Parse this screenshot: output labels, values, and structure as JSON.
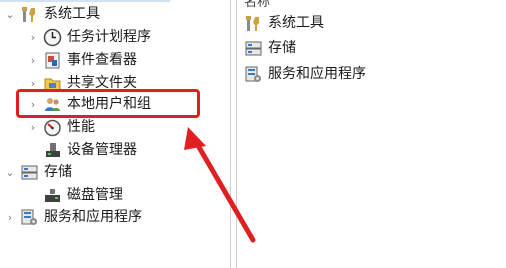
{
  "tree": {
    "items": [
      {
        "label": "系统工具",
        "expander": "expanded",
        "icon": "tools-icon"
      },
      {
        "label": "任务计划程序",
        "expander": "collapsed",
        "icon": "clock-icon"
      },
      {
        "label": "事件查看器",
        "expander": "collapsed",
        "icon": "event-viewer-icon"
      },
      {
        "label": "共享文件夹",
        "expander": "collapsed",
        "icon": "shared-folder-icon"
      },
      {
        "label": "本地用户和组",
        "expander": "collapsed",
        "icon": "users-icon"
      },
      {
        "label": "性能",
        "expander": "collapsed",
        "icon": "performance-icon"
      },
      {
        "label": "设备管理器",
        "expander": "none",
        "icon": "device-manager-icon"
      },
      {
        "label": "存储",
        "expander": "expanded",
        "icon": "storage-icon"
      },
      {
        "label": "磁盘管理",
        "expander": "none",
        "icon": "disk-icon"
      },
      {
        "label": "服务和应用程序",
        "expander": "collapsed",
        "icon": "services-icon"
      }
    ]
  },
  "right_panel": {
    "header": "名称",
    "items": [
      {
        "label": "系统工具",
        "icon": "tools-icon"
      },
      {
        "label": "存储",
        "icon": "storage-icon"
      },
      {
        "label": "服务和应用程序",
        "icon": "services-icon"
      }
    ]
  },
  "annotation": {
    "highlight_color": "#e02020",
    "highlighted_item": "本地用户和组"
  }
}
